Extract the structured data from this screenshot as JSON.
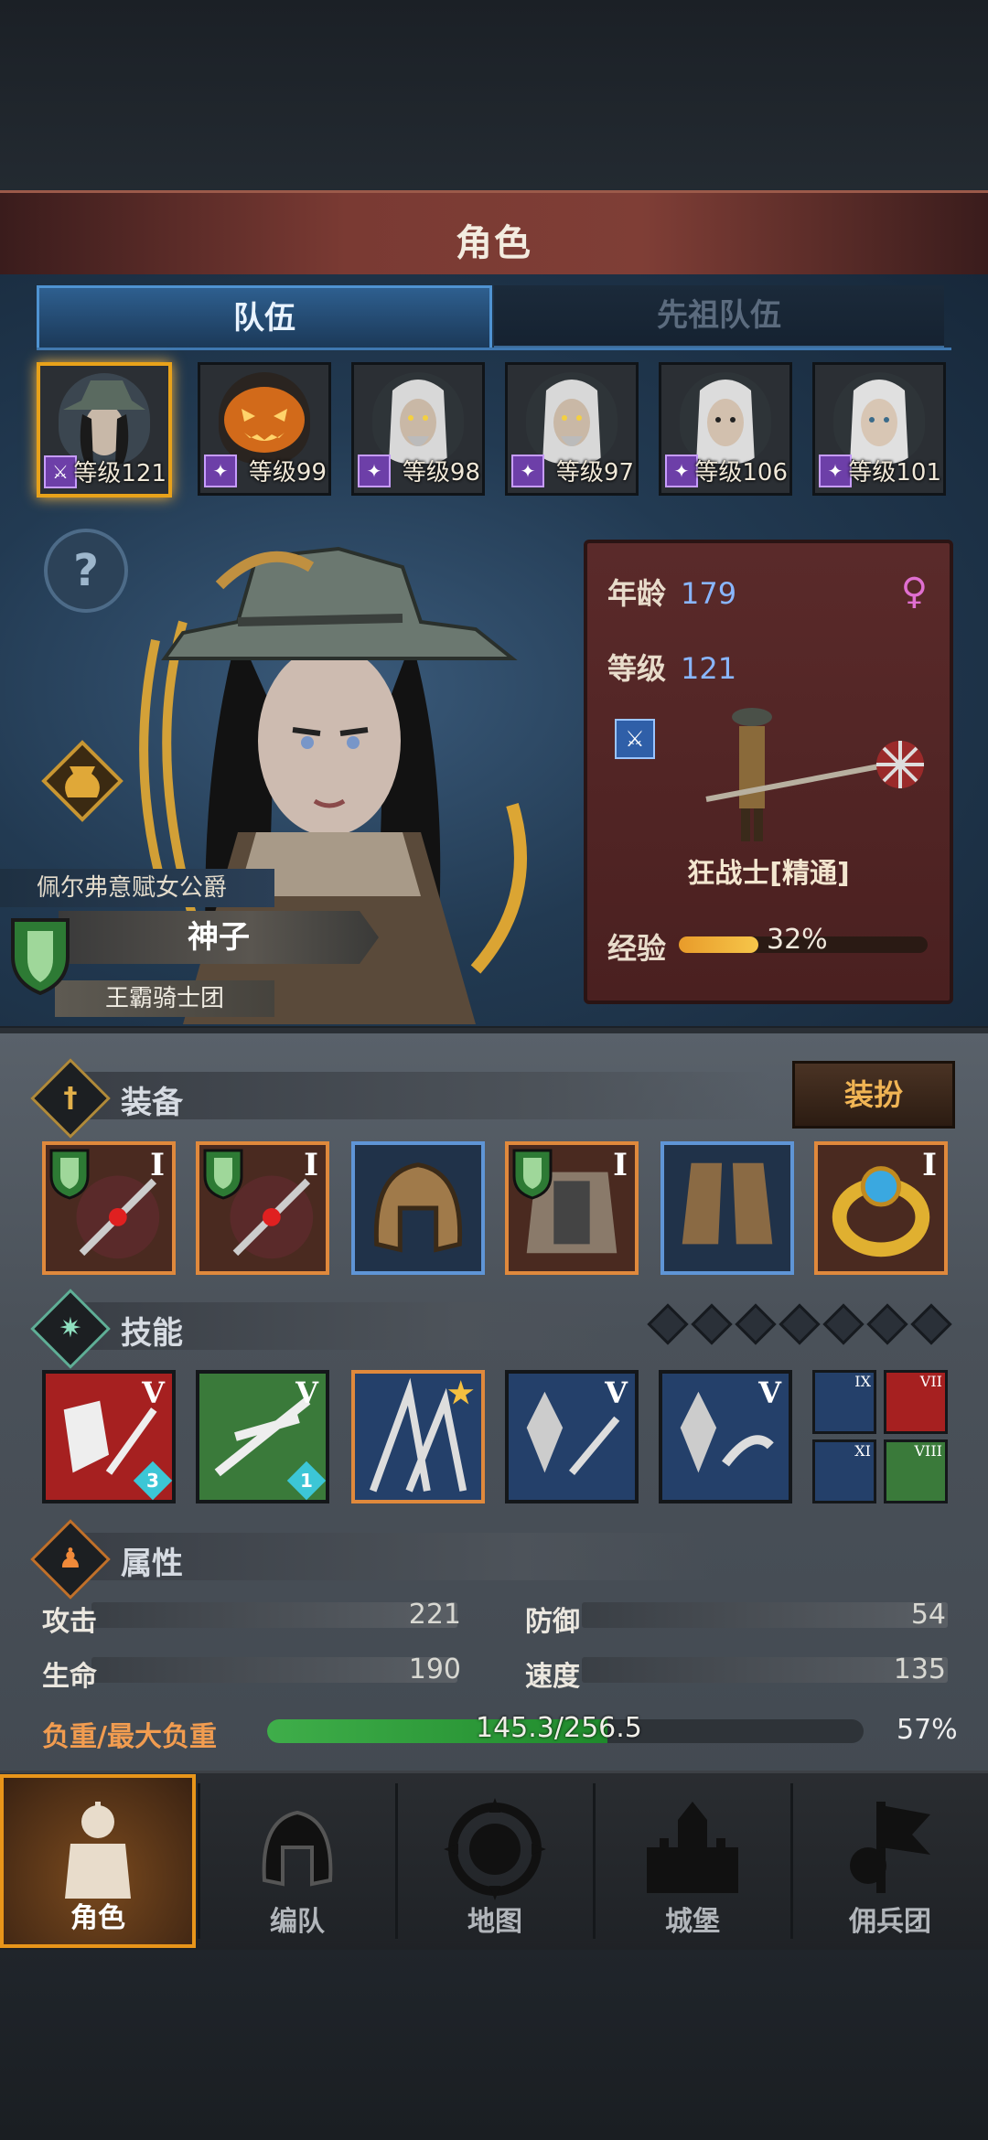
{
  "header": {
    "title": "角色"
  },
  "tabs": [
    {
      "label": "队伍",
      "active": true
    },
    {
      "label": "先祖队伍",
      "active": false
    }
  ],
  "team": [
    {
      "level_label": "等级121",
      "class_icon": "sword-icon",
      "face": "witch-hat"
    },
    {
      "level_label": "等级99",
      "class_icon": "staff-icon",
      "face": "pumpkin"
    },
    {
      "level_label": "等级98",
      "class_icon": "staff-icon",
      "face": "elder-elf"
    },
    {
      "level_label": "等级97",
      "class_icon": "staff-icon",
      "face": "elder-elf"
    },
    {
      "level_label": "等级106",
      "class_icon": "staff-icon",
      "face": "elf"
    },
    {
      "level_label": "等级101",
      "class_icon": "staff-icon",
      "face": "elf"
    }
  ],
  "character": {
    "title": "佩尔弗意赋女公爵",
    "name": "神子",
    "guild": "王霸骑士团",
    "age_label": "年龄",
    "age": "179",
    "level_label": "等级",
    "level": "121",
    "class_name": "狂战士[精通]",
    "exp_label": "经验",
    "exp_pct_text": "32%",
    "exp_fraction": 0.32,
    "gender_icon": "female-icon"
  },
  "equipment": {
    "section_title": "装备",
    "dress_button": "装扮",
    "slots": [
      {
        "name": "weapon-main",
        "tier": "I",
        "rarity": "orange",
        "guild_badge": true
      },
      {
        "name": "weapon-off",
        "tier": "I",
        "rarity": "orange",
        "guild_badge": true
      },
      {
        "name": "helmet",
        "tier": "",
        "rarity": "blue",
        "guild_badge": false
      },
      {
        "name": "armor",
        "tier": "I",
        "rarity": "orange",
        "guild_badge": true
      },
      {
        "name": "boots",
        "tier": "",
        "rarity": "blue",
        "guild_badge": false
      },
      {
        "name": "ring",
        "tier": "I",
        "rarity": "orange",
        "guild_badge": false
      }
    ]
  },
  "skills": {
    "section_title": "技能",
    "empty_slots": 7,
    "main": [
      {
        "tier": "V",
        "badge": "3",
        "bg": "#a62020"
      },
      {
        "tier": "V",
        "badge": "1",
        "bg": "#3a7a3a"
      },
      {
        "tier": "★",
        "badge": "",
        "bg": "#24406a"
      },
      {
        "tier": "V",
        "badge": "",
        "bg": "#24406a"
      },
      {
        "tier": "V",
        "badge": "",
        "bg": "#24406a"
      }
    ],
    "small": [
      {
        "tier": "IX",
        "bg": "#24406a"
      },
      {
        "tier": "VII",
        "bg": "#a62020"
      },
      {
        "tier": "XI",
        "bg": "#24406a"
      },
      {
        "tier": "VIII",
        "bg": "#3a7a3a"
      }
    ]
  },
  "attributes": {
    "section_title": "属性",
    "attack_label": "攻击",
    "attack": "221",
    "defense_label": "防御",
    "defense": "54",
    "hp_label": "生命",
    "hp": "190",
    "speed_label": "速度",
    "speed": "135",
    "load_label": "负重/最大负重",
    "load_text": "145.3/256.5",
    "load_pct_text": "57%",
    "load_fraction": 0.57
  },
  "nav": [
    {
      "label": "角色",
      "icon": "knight-icon",
      "active": true
    },
    {
      "label": "编队",
      "icon": "helmet-icon",
      "active": false
    },
    {
      "label": "地图",
      "icon": "compass-icon",
      "active": false
    },
    {
      "label": "城堡",
      "icon": "castle-icon",
      "active": false
    },
    {
      "label": "佣兵团",
      "icon": "banner-icon",
      "active": false
    }
  ],
  "colors": {
    "accent": "#e8951a",
    "tab_blue": "#4f93d2",
    "title_red": "#7a3a33"
  }
}
